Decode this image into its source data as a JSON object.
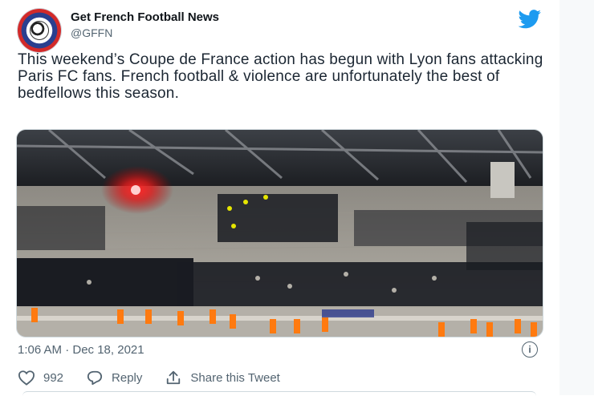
{
  "account": {
    "name": "Get French Football News",
    "handle": "@GFFN"
  },
  "tweet": {
    "text": "This weekend’s Coupe de France action has begun with Lyon fans attacking Paris FC fans. French football & violence are unfortunately the best of bedfellows this season.",
    "timestamp": "1:06 AM · Dec 18, 2021"
  },
  "actions": {
    "like_count": "992",
    "reply_label": "Reply",
    "share_label": "Share this Tweet"
  },
  "colors": {
    "twitter_blue": "#1d9bf0",
    "text_secondary": "#536471"
  },
  "icons": [
    "twitter-bird-icon",
    "info-icon",
    "heart-icon",
    "reply-icon",
    "share-icon"
  ]
}
